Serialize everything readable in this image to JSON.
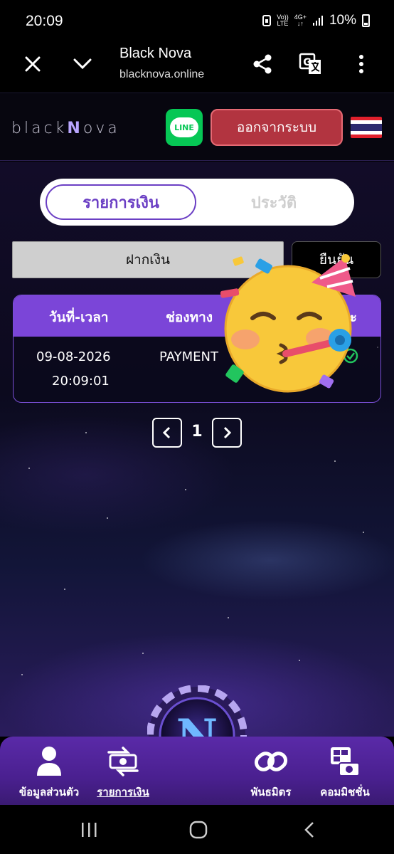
{
  "status_bar": {
    "time": "20:09",
    "network_top": "Vo))",
    "network_bottom": "LTE",
    "network2_top": "4G+",
    "network2_bottom": "↓↑",
    "battery": "10%"
  },
  "browser": {
    "title": "Black Nova",
    "url": "blacknova.online",
    "icons": [
      "close-icon",
      "chevron-down-icon",
      "share-icon",
      "translate-icon",
      "more-vert-icon"
    ]
  },
  "header": {
    "logo_pre": "black",
    "logo_n": "N",
    "logo_post": "ova",
    "line_label": "LINE",
    "logout_label": "ออกจากระบบ",
    "flag": "thailand-flag-icon",
    "colors": {
      "logout": "#b23440",
      "line": "#06c755"
    }
  },
  "tabs": {
    "active": "รายการเงิน",
    "inactive": "ประวัติ"
  },
  "filter": {
    "selected": "ฝากเงิน",
    "confirm_label": "ยืนยัน"
  },
  "table": {
    "headers": [
      "วันที่-เวลา",
      "ช่องทาง",
      "สถานะ"
    ],
    "rows": [
      {
        "date": "09-08-2026",
        "time": "20:09:01",
        "channel": "PAYMENT",
        "status_icon": "check-circle-icon"
      }
    ]
  },
  "pager": {
    "page": "1"
  },
  "bottom_nav": {
    "items": [
      {
        "label": "ข้อมูลส่วนตัว",
        "icon": "user-icon"
      },
      {
        "label": "รายการเงิน",
        "icon": "money-transfer-icon"
      },
      {
        "label": "พันธมิตร",
        "icon": "link-icon"
      },
      {
        "label": "คอมมิชชั่น",
        "icon": "commission-icon"
      }
    ],
    "center_letter": "N"
  },
  "overlay": "partying-face-emoji",
  "colors": {
    "accent": "#7b45d8",
    "tab_active": "#6b3fc4"
  }
}
